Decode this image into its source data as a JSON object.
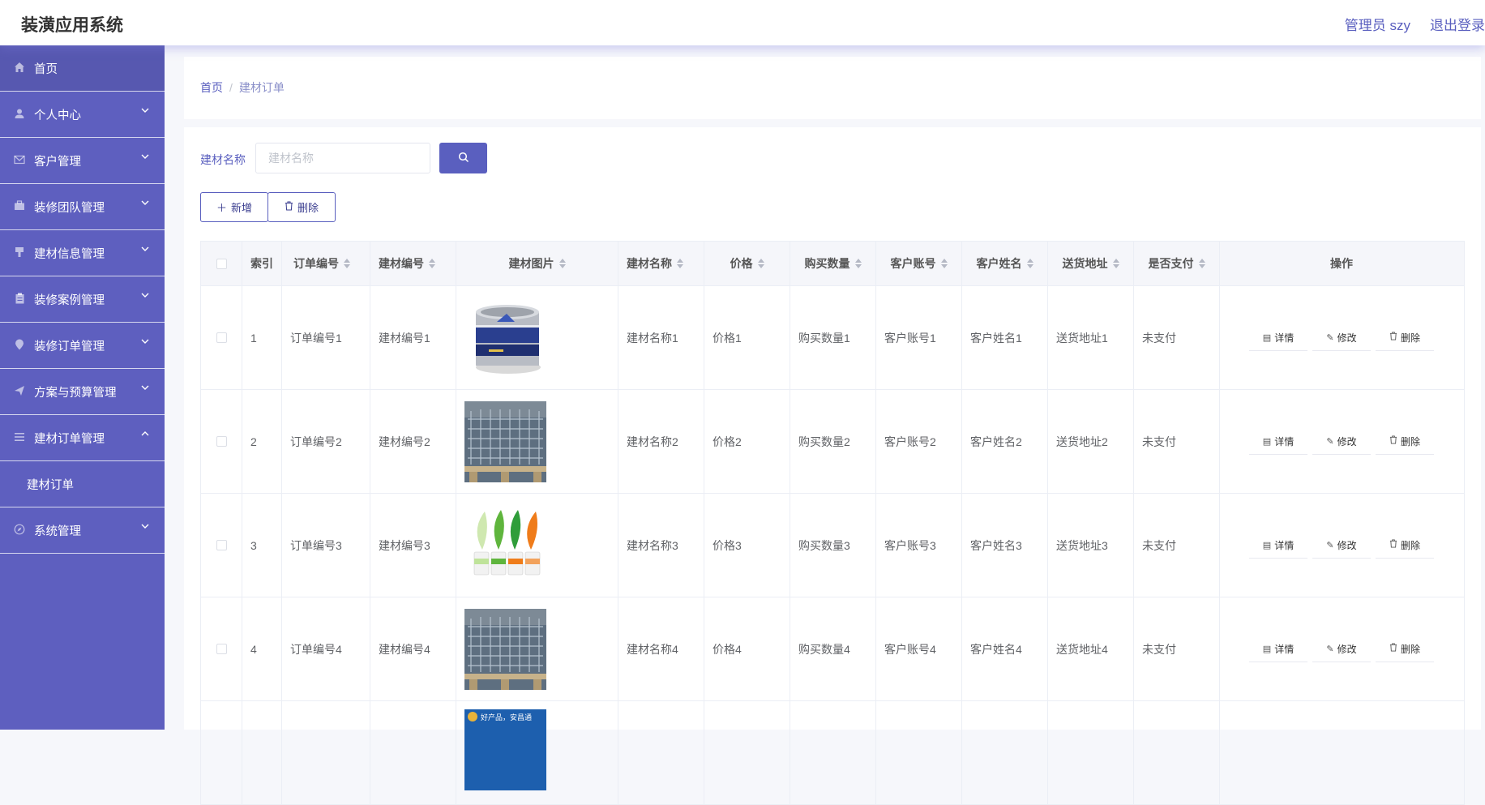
{
  "header": {
    "title": "装潢应用系统",
    "user": "管理员 szy",
    "logout": "退出登录"
  },
  "sidebar": {
    "items": [
      {
        "label": "首页",
        "icon": "home-icon"
      },
      {
        "label": "个人中心",
        "icon": "user-icon"
      },
      {
        "label": "客户管理",
        "icon": "mail-icon"
      },
      {
        "label": "装修团队管理",
        "icon": "briefcase-icon"
      },
      {
        "label": "建材信息管理",
        "icon": "brush-icon"
      },
      {
        "label": "装修案例管理",
        "icon": "clipboard-icon"
      },
      {
        "label": "装修订单管理",
        "icon": "location-icon"
      },
      {
        "label": "方案与预算管理",
        "icon": "send-icon"
      },
      {
        "label": "建材订单管理",
        "icon": "list-icon"
      },
      {
        "label": "系统管理",
        "icon": "compass-icon"
      }
    ],
    "sub_item": "建材订单"
  },
  "breadcrumb": {
    "home": "首页",
    "separator": "/",
    "current": "建材订单"
  },
  "search": {
    "label": "建材名称",
    "placeholder": "建材名称"
  },
  "toolbar": {
    "add_label": "新增",
    "delete_label": "删除"
  },
  "table": {
    "columns": [
      "索引",
      "订单编号",
      "建材编号",
      "建材图片",
      "建材名称",
      "价格",
      "购买数量",
      "客户账号",
      "客户姓名",
      "送货地址",
      "是否支付",
      "操作"
    ],
    "rows": [
      {
        "index": "1",
        "order_no": "订单编号1",
        "material_no": "建材编号1",
        "image": "paint-can",
        "name": "建材名称1",
        "price": "价格1",
        "qty": "购买数量1",
        "account": "客户账号1",
        "customer": "客户姓名1",
        "address": "送货地址1",
        "paid": "未支付"
      },
      {
        "index": "2",
        "order_no": "订单编号2",
        "material_no": "建材编号2",
        "image": "steel-mesh-pallet",
        "name": "建材名称2",
        "price": "价格2",
        "qty": "购买数量2",
        "account": "客户账号2",
        "customer": "客户姓名2",
        "address": "送货地址2",
        "paid": "未支付"
      },
      {
        "index": "3",
        "order_no": "订单编号3",
        "material_no": "建材编号3",
        "image": "paint-buckets-leaves",
        "name": "建材名称3",
        "price": "价格3",
        "qty": "购买数量3",
        "account": "客户账号3",
        "customer": "客户姓名3",
        "address": "送货地址3",
        "paid": "未支付"
      },
      {
        "index": "4",
        "order_no": "订单编号4",
        "material_no": "建材编号4",
        "image": "steel-mesh-pallet",
        "name": "建材名称4",
        "price": "价格4",
        "qty": "购买数量4",
        "account": "客户账号4",
        "customer": "客户姓名4",
        "address": "送货地址4",
        "paid": "未支付"
      },
      {
        "index": "",
        "order_no": "",
        "material_no": "",
        "image": "ad-banner",
        "name": "",
        "price": "",
        "qty": "",
        "account": "",
        "customer": "",
        "address": "",
        "paid": "",
        "banner_text": "好产品，安昌通"
      }
    ],
    "actions": {
      "detail": "详情",
      "edit": "修改",
      "delete": "删除"
    }
  },
  "colors": {
    "sidebar": "#5e5fbf",
    "accent": "#5a5fbf"
  }
}
